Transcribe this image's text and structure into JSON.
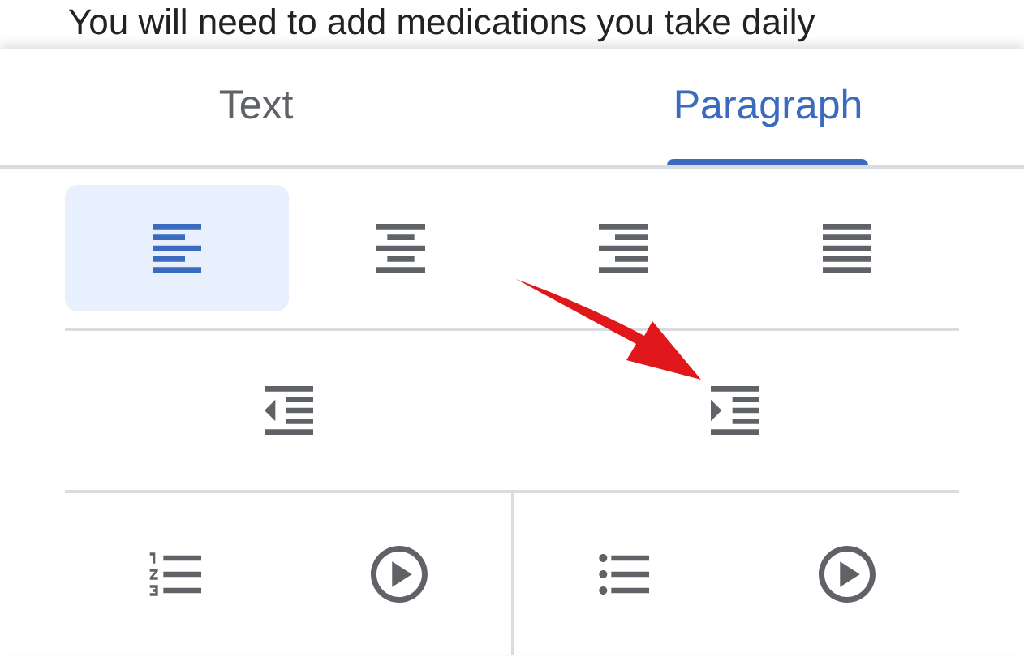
{
  "document": {
    "text": "You will need to add medications you take daily"
  },
  "tabs": [
    {
      "label": "Text",
      "selected": false
    },
    {
      "label": "Paragraph",
      "selected": true
    }
  ],
  "alignment": [
    {
      "kind": "left",
      "selected": true
    },
    {
      "kind": "center",
      "selected": false
    },
    {
      "kind": "right",
      "selected": false
    },
    {
      "kind": "justify",
      "selected": false
    }
  ],
  "indent": [
    {
      "kind": "decrease"
    },
    {
      "kind": "increase"
    }
  ],
  "lists": [
    {
      "kind": "numbered"
    },
    {
      "kind": "bulleted"
    }
  ]
}
